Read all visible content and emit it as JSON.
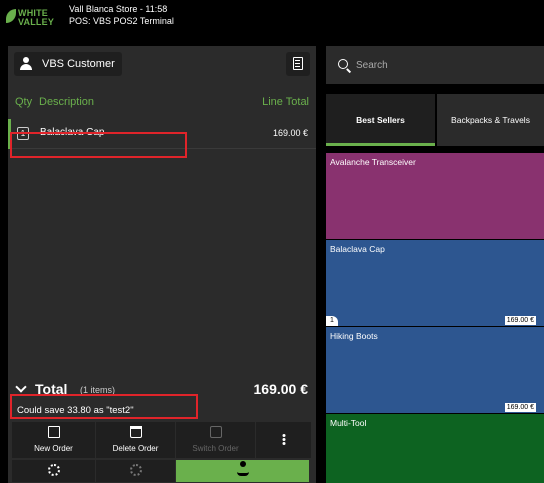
{
  "topbar": {
    "logo_line1": "WHITE",
    "logo_line2": "VALLEY",
    "store_time": "Vall Blanca Store - 11:58",
    "pos_terminal": "POS: VBS POS2 Terminal"
  },
  "ticket": {
    "customer_label": "VBS Customer",
    "columns": {
      "qty": "Qty",
      "description": "Description",
      "line_total": "Line Total"
    },
    "lines": [
      {
        "qty": "1",
        "description": "Balaclava Cap",
        "amount": "169.00 €"
      }
    ],
    "total_label": "Total",
    "items_count": "(1 items)",
    "total_amount": "169.00 €",
    "message": "Could save 33.80 as \"test2\""
  },
  "actions": {
    "new_order": "New Order",
    "delete_order": "Delete Order",
    "switch_order": "Switch Order"
  },
  "search": {
    "placeholder": "Search"
  },
  "tabs": [
    {
      "label": "Best Sellers",
      "active": true
    },
    {
      "label": "Backpacks & Travels",
      "active": false
    }
  ],
  "products": [
    {
      "name": "Avalanche Transceiver",
      "price": "",
      "qty": "",
      "color": "#89326f"
    },
    {
      "name": "Balaclava Cap",
      "price": "169.00 €",
      "qty": "1",
      "color": "#2d5690"
    },
    {
      "name": "Hiking Boots",
      "price": "169.00 €",
      "qty": "",
      "color": "#2d5690"
    },
    {
      "name": "Multi-Tool",
      "price": "",
      "qty": "",
      "color": "#0d6321"
    }
  ],
  "colors": {
    "accent_green": "#6ab04c",
    "panel": "#2b2b2b",
    "highlight_red": "#e0242a"
  }
}
